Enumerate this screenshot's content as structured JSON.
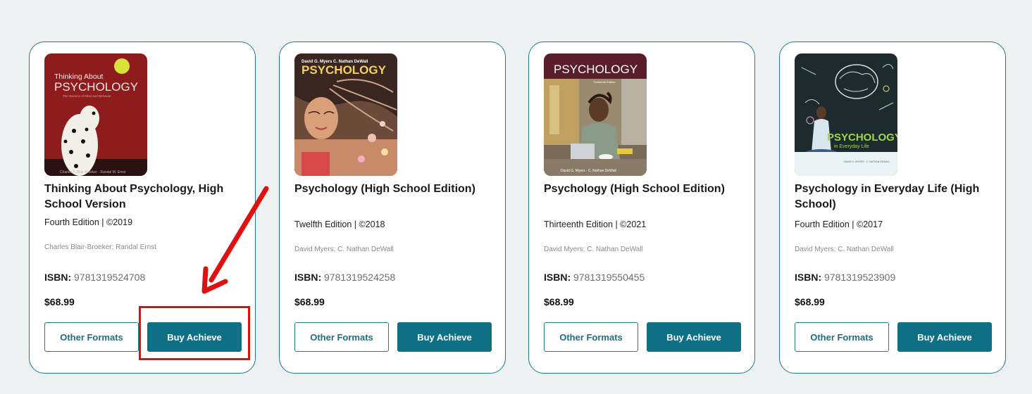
{
  "products": [
    {
      "title": "Thinking About Psychology, High School Version",
      "edition": "Fourth Edition | ©2019",
      "authors": "Charles Blair-Broeker; Randal Ernst",
      "isbn_label": "ISBN:",
      "isbn": "9781319524708",
      "price": "$68.99",
      "other_formats_label": "Other Formats",
      "buy_label": "Buy Achieve",
      "cover": {
        "lines": [
          "Thinking About",
          "PSYCHOLOGY"
        ],
        "tagline": "The Science of Mind and Behavior",
        "byline": "Charles T. Blair-Broeker · Randal M. Ernst",
        "bg": "#8e1c1c"
      }
    },
    {
      "title": "Psychology (High School Edition)",
      "edition": "Twelfth Edition | ©2018",
      "authors": "David Myers; C. Nathan DeWall",
      "isbn_label": "ISBN:",
      "isbn": "9781319524258",
      "price": "$68.99",
      "other_formats_label": "Other Formats",
      "buy_label": "Buy Achieve",
      "cover": {
        "lines": [
          "David G. Myers  C. Nathan DeWall",
          "PSYCHOLOGY"
        ],
        "bg": "#6b4a3a"
      }
    },
    {
      "title": "Psychology (High School Edition)",
      "edition": "Thirteenth Edition | ©2021",
      "authors": "David Myers; C. Nathan DeWall",
      "isbn_label": "ISBN:",
      "isbn": "9781319550455",
      "price": "$68.99",
      "other_formats_label": "Other Formats",
      "buy_label": "Buy Achieve",
      "cover": {
        "lines": [
          "PSYCHOLOGY"
        ],
        "tagline": "Thirteenth Edition",
        "byline": "David G. Myers · C. Nathan DeWall",
        "bg": "#9a8a70"
      }
    },
    {
      "title": "Psychology in Everyday Life (High School)",
      "edition": "Fourth Edition | ©2017",
      "authors": "David Myers; C. Nathan DeWall",
      "isbn_label": "ISBN:",
      "isbn": "9781319523909",
      "price": "$68.99",
      "other_formats_label": "Other Formats",
      "buy_label": "Buy Achieve",
      "cover": {
        "lines": [
          "PSYCHOLOGY",
          "in Everyday Life"
        ],
        "byline": "DAVID G. MYERS · C. NATHAN DEWALL",
        "bg": "#1d2b2e"
      }
    }
  ],
  "colors": {
    "accent": "#0f7085",
    "card_border": "#1f7a8c",
    "annotation": "#e01010",
    "page_bg": "#eef1f2"
  }
}
